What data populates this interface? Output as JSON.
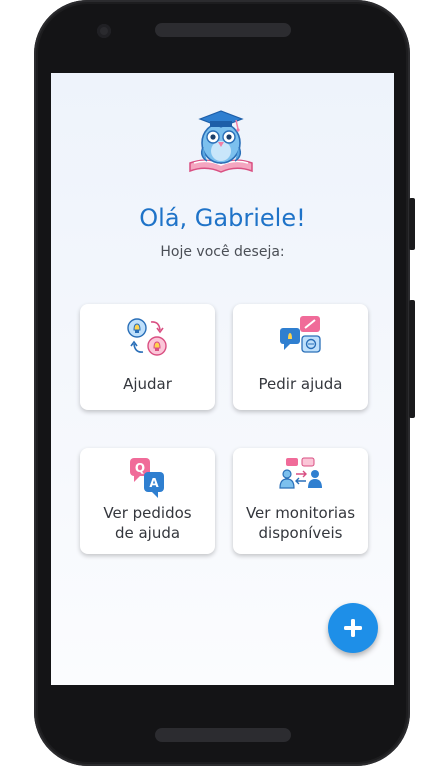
{
  "greeting": {
    "title": "Olá, Gabriele!",
    "subtitle": "Hoje você deseja:"
  },
  "actions": [
    {
      "label": "Ajudar",
      "icon": "help-exchange-icon"
    },
    {
      "label": "Pedir ajuda",
      "icon": "ask-help-chat-icon"
    },
    {
      "label": "Ver pedidos\nde ajuda",
      "icon": "qa-bubbles-icon"
    },
    {
      "label": "Ver monitorias\ndisponíveis",
      "icon": "mentors-conversation-icon"
    }
  ],
  "fab": {
    "icon": "plus-icon"
  },
  "colors": {
    "accent": "#1e8fe8",
    "title": "#1f73c8",
    "pink": "#f06b99",
    "blue": "#3a86d8"
  }
}
